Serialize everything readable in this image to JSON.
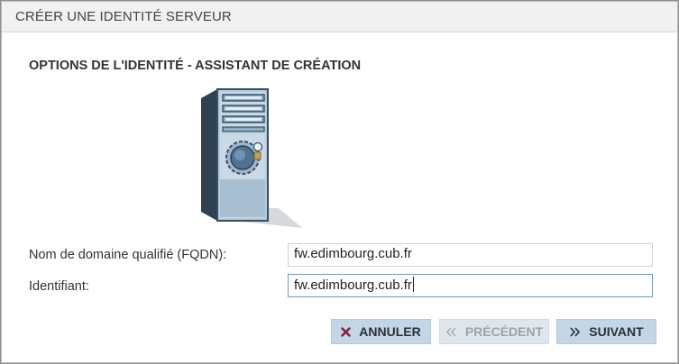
{
  "dialog": {
    "title": "CRÉER UNE IDENTITÉ SERVEUR",
    "section_title": "OPTIONS DE L'IDENTITÉ - ASSISTANT DE CRÉATION",
    "illustration": "server-tower-icon"
  },
  "form": {
    "fqdn_label": "Nom de domaine qualifié (FQDN):",
    "fqdn_value": "fw.edimbourg.cub.fr",
    "identifier_label": "Identifiant:",
    "identifier_value": "fw.edimbourg.cub.fr"
  },
  "buttons": {
    "cancel_label": "ANNULER",
    "cancel_icon": "x-icon",
    "previous_label": "PRÉCÉDENT",
    "previous_icon": "double-chevron-left-icon",
    "previous_enabled": false,
    "next_label": "SUIVANT",
    "next_icon": "double-chevron-right-icon"
  },
  "colors": {
    "button_bg": "#c2d6e6",
    "cancel_icon": "#8a1a3a",
    "focus_border": "#5a9fd0"
  }
}
